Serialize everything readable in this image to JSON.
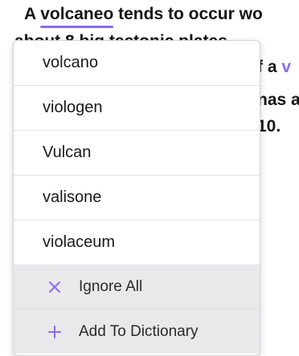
{
  "document": {
    "line1": {
      "pre": "A ",
      "misspelled": "volcaneo",
      "post": " tends to occur wo"
    },
    "line2": {
      "text": "about 8 big tectonic plates."
    },
    "line3": {
      "text": "f a ",
      "highlight": "v"
    },
    "line4": {
      "text": "nas a"
    },
    "line5": {
      "text": "10."
    }
  },
  "popup": {
    "suggestions": [
      {
        "label": "volcano"
      },
      {
        "label": "viologen"
      },
      {
        "label": "Vulcan"
      },
      {
        "label": "valisone"
      },
      {
        "label": "violaceum"
      }
    ],
    "actions": {
      "ignore_all": {
        "icon": "close-icon",
        "label": "Ignore All"
      },
      "add_to_dictionary": {
        "icon": "plus-icon",
        "label": "Add To Dictionary"
      }
    }
  },
  "colors": {
    "accent": "#8c6cf0",
    "action_background": "#e9e9ec"
  }
}
